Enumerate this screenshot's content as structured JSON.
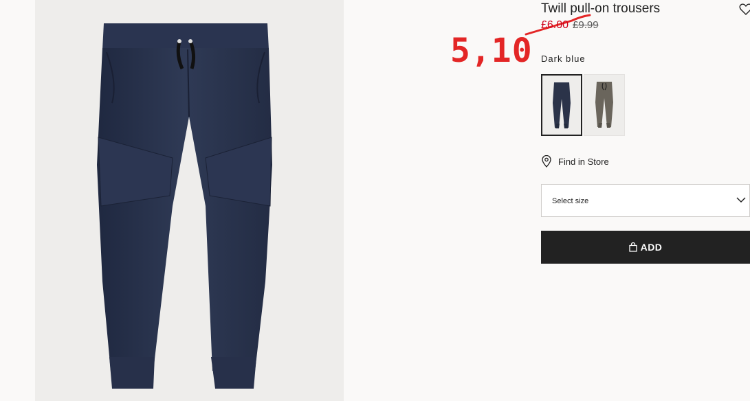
{
  "product": {
    "title": "Twill pull-on trousers",
    "sale_price": "£6.00",
    "original_price": "£9.99",
    "color_label": "Dark blue",
    "favorite_icon": "heart-icon"
  },
  "annotation": {
    "handwritten_price": "5,10",
    "color": "#e32626"
  },
  "swatches": [
    {
      "name": "Dark blue",
      "color": "#2b3349",
      "selected": true
    },
    {
      "name": "Dark grey",
      "color": "#6a655c",
      "selected": false
    }
  ],
  "store": {
    "label": "Find in Store",
    "icon": "location-pin-icon"
  },
  "size_select": {
    "label": "Select size",
    "icon": "chevron-down-icon"
  },
  "add_button": {
    "label": "ADD",
    "icon": "shopping-bag-icon"
  },
  "colors": {
    "background": "#faf9f8",
    "image_background": "#eeedeb",
    "button": "#222222",
    "sale": "#d0021b"
  }
}
